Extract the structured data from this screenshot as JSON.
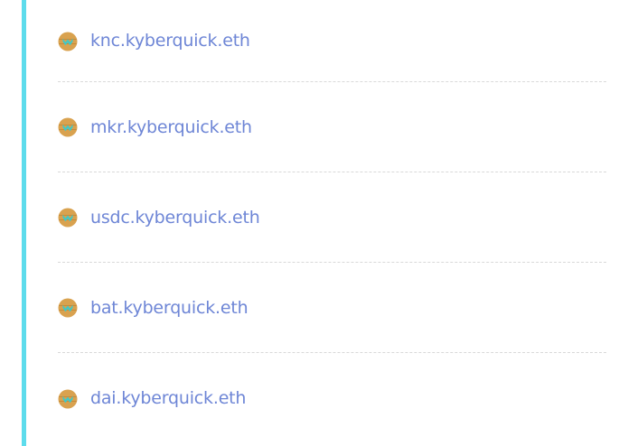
{
  "colors": {
    "accent_bar": "#5ddcec",
    "link": "#6e86d6",
    "divider": "#d9d9d9"
  },
  "list": {
    "items": [
      {
        "icon": "kyber-token-icon",
        "label": "knc.kyberquick.eth"
      },
      {
        "icon": "kyber-token-icon",
        "label": "mkr.kyberquick.eth"
      },
      {
        "icon": "kyber-token-icon",
        "label": "usdc.kyberquick.eth"
      },
      {
        "icon": "kyber-token-icon",
        "label": "bat.kyberquick.eth"
      },
      {
        "icon": "kyber-token-icon",
        "label": "dai.kyberquick.eth"
      }
    ]
  }
}
